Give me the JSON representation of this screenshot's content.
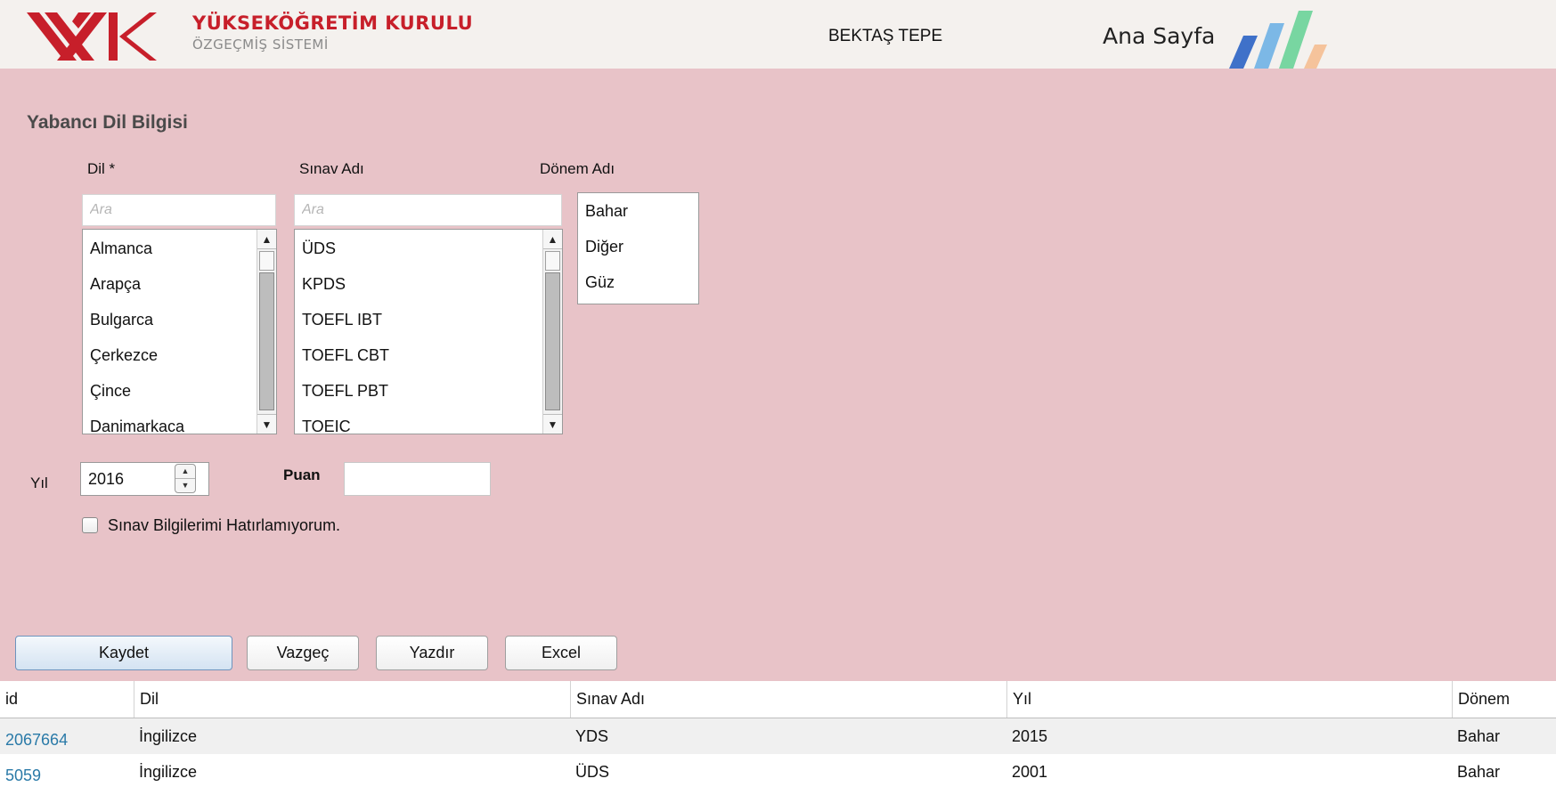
{
  "header": {
    "brand_title": "YÜKSEKÖĞRETİM KURULU",
    "brand_subtitle": "ÖZGEÇMİŞ SİSTEMİ",
    "user_name": "BEKTAŞ TEPE",
    "home_link": "Ana Sayfa",
    "logo_color": "#c71f2a",
    "stripe_colors": [
      "#3f71c9",
      "#7cb8e6",
      "#78d6a1",
      "#f5c39b"
    ]
  },
  "form": {
    "section_title": "Yabancı Dil Bilgisi",
    "dil": {
      "label": "Dil *",
      "search_placeholder": "Ara",
      "options": [
        "Almanca",
        "Arapça",
        "Bulgarca",
        "Çerkezce",
        "Çince",
        "Danimarkaca"
      ]
    },
    "sinav": {
      "label": "Sınav Adı",
      "search_placeholder": "Ara",
      "options": [
        "ÜDS",
        "KPDS",
        "TOEFL IBT",
        "TOEFL CBT",
        "TOEFL PBT",
        "TOEIC"
      ]
    },
    "donem": {
      "label": "Dönem Adı",
      "options": [
        "Bahar",
        "Diğer",
        "Güz"
      ]
    },
    "yil": {
      "label": "Yıl",
      "value": "2016"
    },
    "puan": {
      "label": "Puan",
      "value": ""
    },
    "checkbox_label": "Sınav Bilgilerimi Hatırlamıyorum.",
    "checkbox_checked": false
  },
  "buttons": {
    "save": "Kaydet",
    "cancel": "Vazgeç",
    "print": "Yazdır",
    "excel": "Excel"
  },
  "table": {
    "headers": [
      "id",
      "Dil",
      "Sınav Adı",
      "Yıl",
      "Dönem"
    ],
    "rows": [
      [
        "2067664",
        "İngilizce",
        "YDS",
        "2015",
        "Bahar"
      ],
      [
        "5059",
        "İngilizce",
        "ÜDS",
        "2001",
        "Bahar"
      ]
    ]
  }
}
